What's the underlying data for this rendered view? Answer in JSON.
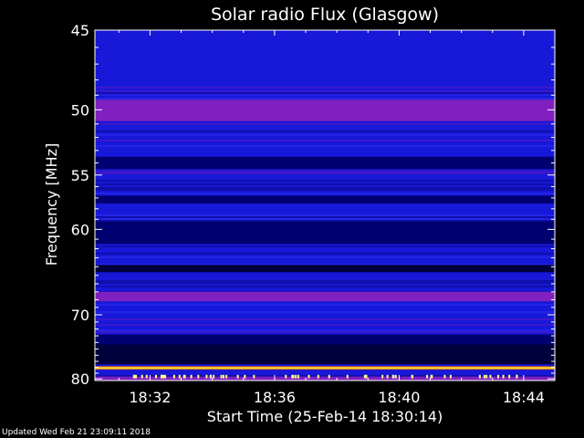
{
  "chart_data": {
    "type": "heatmap",
    "title": "Solar radio Flux (Glasgow)",
    "xlabel": "Start Time (25-Feb-14 18:30:14)",
    "ylabel": "Frequency [MHz]",
    "x_ticks": [
      "18:32",
      "18:36",
      "18:40",
      "18:44"
    ],
    "x_tick_minutes": [
      32,
      36,
      40,
      44
    ],
    "xlim_minutes": [
      30.23,
      45.0
    ],
    "y_ticks": [
      45,
      50,
      55,
      60,
      70,
      80
    ],
    "ylim": [
      45,
      80.3
    ],
    "y_scale": "reciprocal",
    "grid": false,
    "colors": {
      "background": "#000000",
      "low": "#000070",
      "base": "#1818d8",
      "mid": "#8020c0",
      "high": "#ffff40"
    },
    "bands_mhz": [
      {
        "from": 45.0,
        "to": 47.5,
        "level": "base"
      },
      {
        "from": 49.3,
        "to": 50.8,
        "level": "mid"
      },
      {
        "from": 53.5,
        "to": 54.5,
        "level": "low"
      },
      {
        "from": 56.8,
        "to": 57.5,
        "level": "low"
      },
      {
        "from": 59.2,
        "to": 61.5,
        "level": "low"
      },
      {
        "from": 63.8,
        "to": 64.6,
        "level": "dark"
      },
      {
        "from": 67.0,
        "to": 68.2,
        "level": "mid"
      },
      {
        "from": 72.8,
        "to": 74.3,
        "level": "low"
      },
      {
        "from": 74.3,
        "to": 77.5,
        "level": "dark"
      },
      {
        "from": 77.8,
        "to": 78.4,
        "level": "high"
      },
      {
        "from": 79.6,
        "to": 80.3,
        "level": "mid"
      }
    ]
  },
  "footer": {
    "updated": "Updated Wed Feb 21 23:09:11 2018"
  }
}
